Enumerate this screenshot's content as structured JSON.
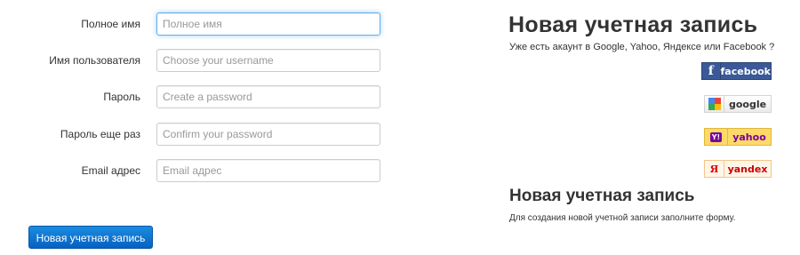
{
  "form": {
    "fields": [
      {
        "label": "Полное имя",
        "placeholder": "Полное имя"
      },
      {
        "label": "Имя пользователя",
        "placeholder": "Choose your username"
      },
      {
        "label": "Пароль",
        "placeholder": "Create a password"
      },
      {
        "label": "Пароль еще раз",
        "placeholder": "Confirm your password"
      },
      {
        "label": "Email адрес",
        "placeholder": "Email адрес"
      }
    ],
    "submit_label": "Новая учетная запись"
  },
  "sidebar": {
    "title": "Новая учетная запись",
    "subtitle": "Уже есть акаунт в Google, Yahoo, Яндексе или Facebook ?",
    "providers": {
      "facebook": {
        "label": "facebook",
        "icon": "facebook-icon",
        "color": "#3b5998"
      },
      "google": {
        "label": "google",
        "icon": "google-icon"
      },
      "yahoo": {
        "label": "yahoo",
        "icon": "yahoo-icon",
        "badge": "Y!",
        "color": "#7b0099"
      },
      "yandex": {
        "label": "yandex",
        "icon": "yandex-icon",
        "glyph": "Я",
        "color": "#cc0000"
      }
    },
    "title2": "Новая учетная запись",
    "subtitle2": "Для создания новой учетной записи заполните форму."
  },
  "colors": {
    "accent": "#0b6fd0",
    "focus": "#66afe9"
  }
}
